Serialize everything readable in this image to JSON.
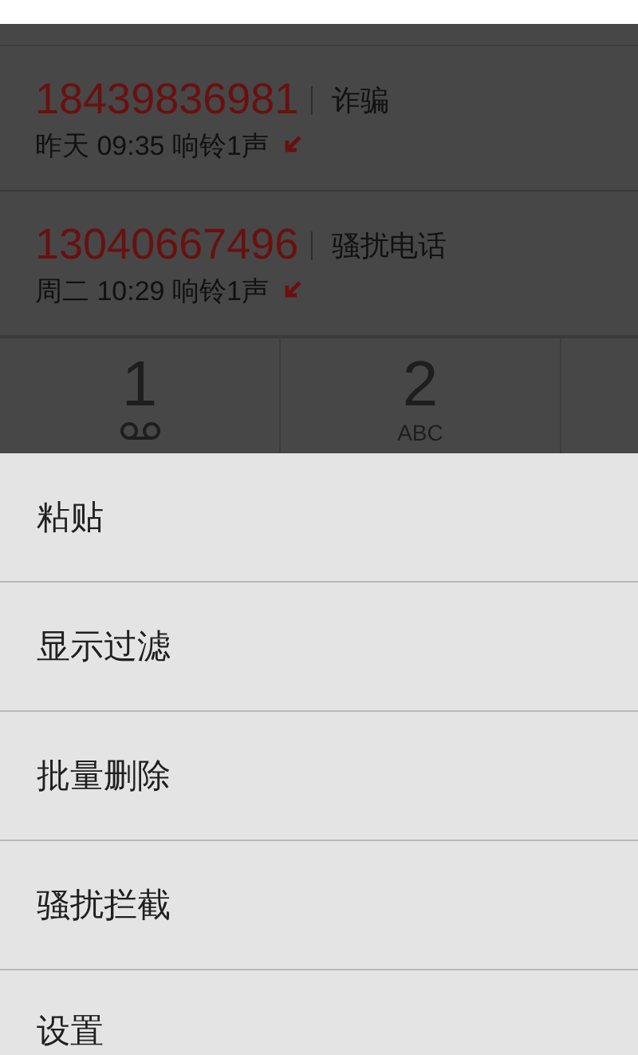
{
  "calls": [
    {
      "number": "18439836981",
      "tag": "诈骗",
      "time": "昨天 09:35 响铃1声",
      "kind": "incoming"
    },
    {
      "number": "13040667496",
      "tag": "骚扰电话",
      "time": "周二 10:29 响铃1声",
      "kind": "incoming"
    }
  ],
  "keypad": [
    {
      "digit": "1",
      "kind": "voicemail"
    },
    {
      "digit": "2",
      "letters": "ABC",
      "kind": "letters"
    },
    {
      "kind": "blank"
    }
  ],
  "menu": {
    "items": [
      "粘贴",
      "显示过滤",
      "批量删除",
      "骚扰拦截",
      "设置"
    ]
  }
}
